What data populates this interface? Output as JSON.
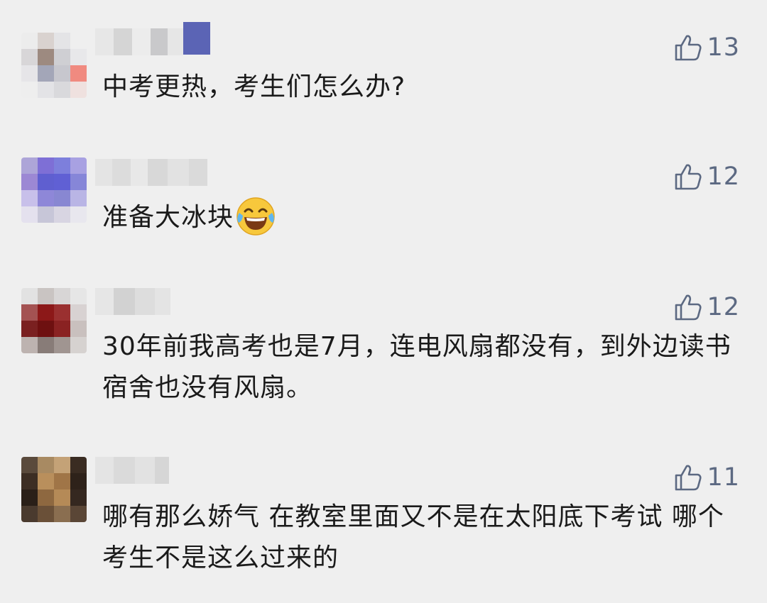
{
  "comments": [
    {
      "text": "中考更热，考生们怎么办?",
      "likes": "13",
      "emoji": ""
    },
    {
      "text": "准备大冰块",
      "likes": "12",
      "emoji": "laughing-tears-emoji"
    },
    {
      "text": "30年前我高考也是7月，连电风扇都没有，到外边读书宿舍也没有风扇。",
      "likes": "12",
      "emoji": ""
    },
    {
      "text": "哪有那么娇气 在教室里面又不是在太阳底下考试 哪个考生不是这么过来的",
      "likes": "11",
      "emoji": ""
    }
  ],
  "icons": {
    "like": "thumbs-up-outline-icon"
  },
  "colors": {
    "background": "#efefef",
    "text": "#1a1a1a",
    "like": "#5c6982"
  }
}
